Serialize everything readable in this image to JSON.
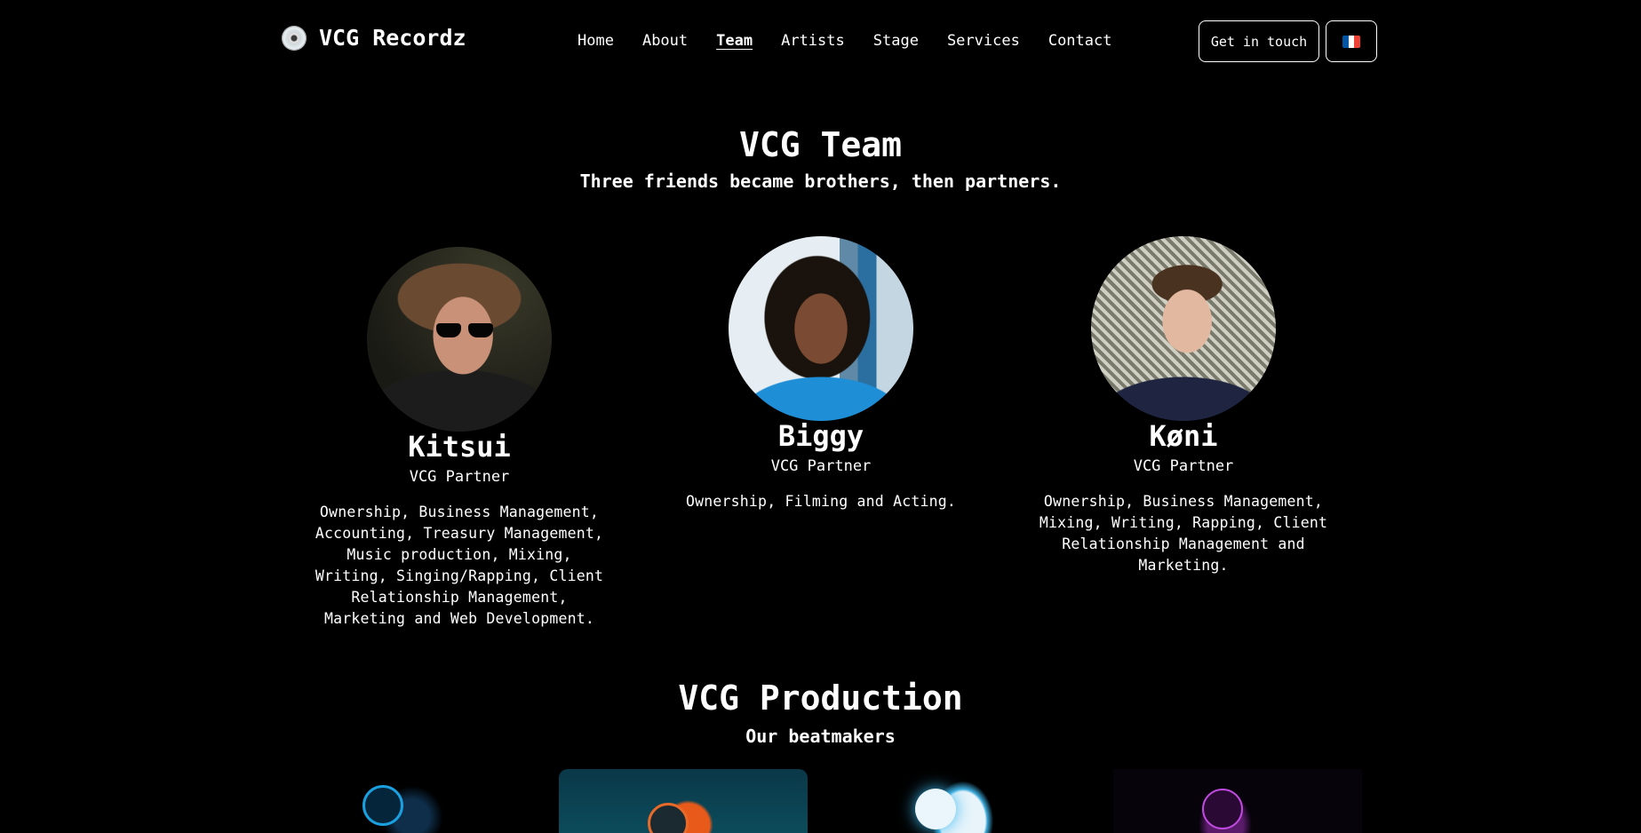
{
  "header": {
    "brand": "VCG Recordz",
    "nav": [
      "Home",
      "About",
      "Team",
      "Artists",
      "Stage",
      "Services",
      "Contact"
    ],
    "active_nav": "Team",
    "cta_label": "Get in touch",
    "language_flag": "fr-flag-icon"
  },
  "team": {
    "title": "VCG Team",
    "subtitle": "Three friends became brothers, then partners.",
    "members": [
      {
        "name": "Kitsui",
        "role": "VCG Partner",
        "description": "Ownership, Business Management, Accounting, Treasury Management, Music production, Mixing, Writing, Singing/Rapping, Client Relationship Management, Marketing and Web Development."
      },
      {
        "name": "Biggy",
        "role": "VCG Partner",
        "description": "Ownership, Filming and Acting."
      },
      {
        "name": "Køni",
        "role": "VCG Partner",
        "description": "Ownership, Business Management, Mixing, Writing, Rapping, Client Relationship Management and Marketing."
      }
    ]
  },
  "production": {
    "title": "VCG Production",
    "subtitle": "Our beatmakers"
  },
  "colors": {
    "background": "#000000",
    "text": "#ffffff",
    "flag_blue": "#0055a4",
    "flag_white": "#ffffff",
    "flag_red": "#ef4135"
  }
}
